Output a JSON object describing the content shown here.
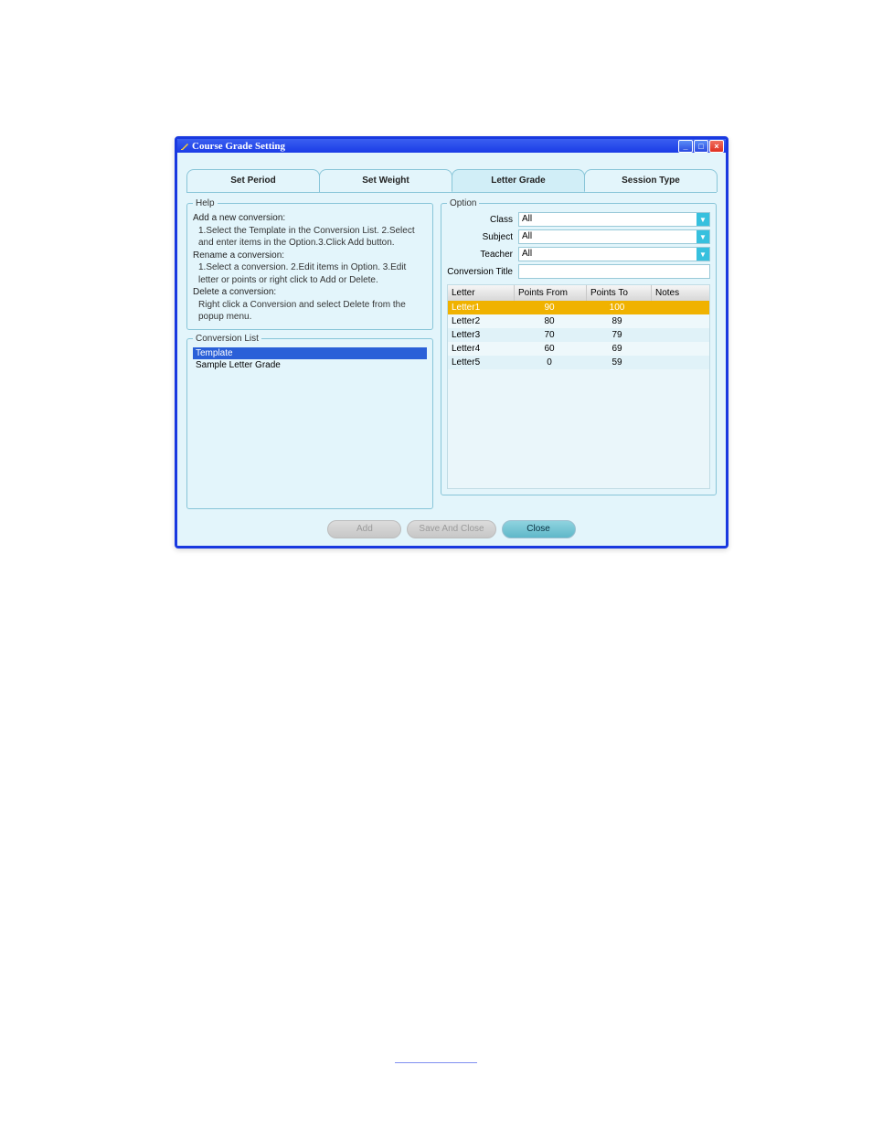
{
  "window": {
    "title": "Course Grade Setting"
  },
  "tabs": [
    {
      "label": "Set Period"
    },
    {
      "label": "Set Weight"
    },
    {
      "label": "Letter Grade"
    },
    {
      "label": "Session Type"
    }
  ],
  "help": {
    "legend": "Help",
    "add_head": "Add a new conversion:",
    "add_body": "1.Select the Template in the Conversion List. 2.Select and enter items in the Option.3.Click Add button.",
    "ren_head": "Rename a conversion:",
    "ren_body": "1.Select a conversion. 2.Edit items in Option. 3.Edit letter or points or right click to Add or Delete.",
    "del_head": "Delete a conversion:",
    "del_body": "Right click a Conversion and select Delete from the popup menu."
  },
  "conversion_list": {
    "legend": "Conversion List",
    "items": [
      {
        "label": "Template",
        "selected": true
      },
      {
        "label": "Sample Letter Grade",
        "selected": false
      }
    ]
  },
  "option": {
    "legend": "Option",
    "class_label": "Class",
    "class_value": "All",
    "subject_label": "Subject",
    "subject_value": "All",
    "teacher_label": "Teacher",
    "teacher_value": "All",
    "title_label": "Conversion Title",
    "title_value": ""
  },
  "grid": {
    "headers": {
      "letter": "Letter",
      "from": "Points From",
      "to": "Points To",
      "notes": "Notes"
    },
    "rows": [
      {
        "letter": "Letter1",
        "from": "90",
        "to": "100",
        "notes": "",
        "selected": true
      },
      {
        "letter": "Letter2",
        "from": "80",
        "to": "89",
        "notes": "",
        "selected": false
      },
      {
        "letter": "Letter3",
        "from": "70",
        "to": "79",
        "notes": "",
        "selected": false
      },
      {
        "letter": "Letter4",
        "from": "60",
        "to": "69",
        "notes": "",
        "selected": false
      },
      {
        "letter": "Letter5",
        "from": "0",
        "to": "59",
        "notes": "",
        "selected": false
      }
    ]
  },
  "buttons": {
    "add": "Add",
    "save": "Save And Close",
    "close": "Close"
  }
}
